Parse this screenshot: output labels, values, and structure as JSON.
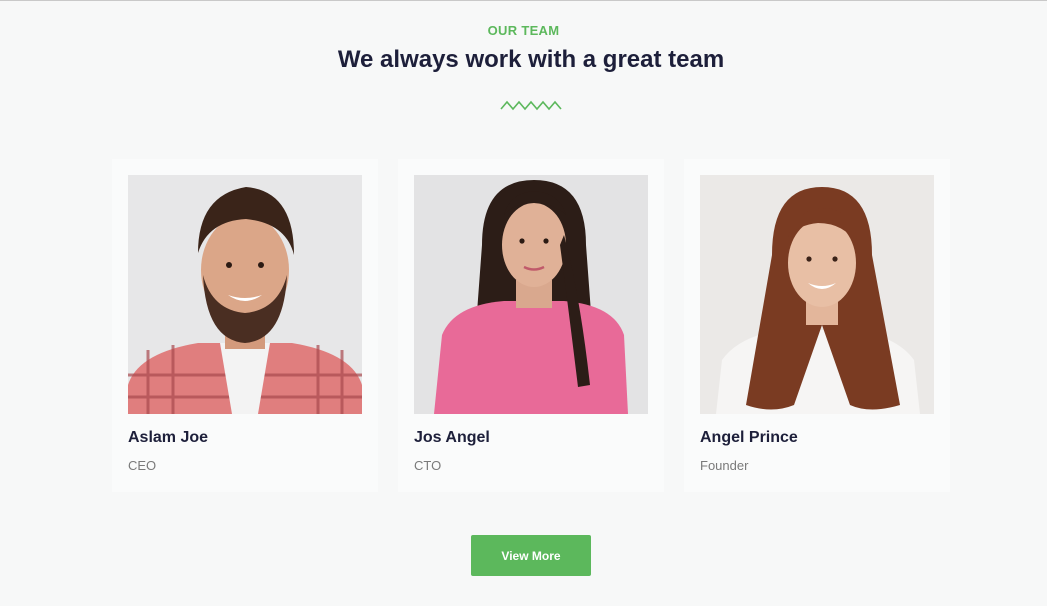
{
  "section": {
    "eyebrow": "OUR TEAM",
    "title": "We always work with a great team",
    "accent_color": "#5cb85c",
    "title_color": "#1d1f3a"
  },
  "team": [
    {
      "name": "Aslam Joe",
      "role": "CEO"
    },
    {
      "name": "Jos Angel",
      "role": "CTO"
    },
    {
      "name": "Angel Prince",
      "role": "Founder"
    }
  ],
  "cta": {
    "label": "View More"
  }
}
